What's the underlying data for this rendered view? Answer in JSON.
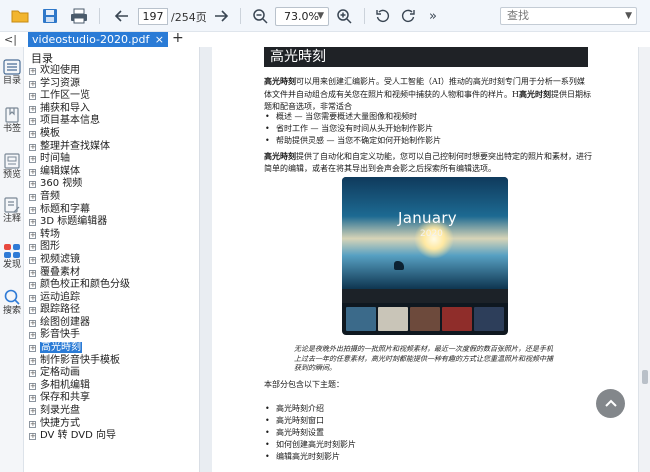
{
  "toolbar": {
    "icons": [
      "folder-icon",
      "save-icon",
      "print-icon",
      "back-arrow-icon",
      "forward-arrow-icon",
      "zoom-out-icon",
      "zoom-in-icon",
      "rotate-left-icon",
      "rotate-right-icon",
      "more-icon"
    ],
    "page_current": "197",
    "page_total": "/254页",
    "zoom": "73.0%",
    "search_placeholder": "查找",
    "more_label": "»"
  },
  "tabs": {
    "toggle": "<|",
    "active_tab": "videostudio-2020.pdf",
    "close": "×",
    "add": "+"
  },
  "rail": {
    "items": [
      {
        "label": "目录",
        "icon": "toc-icon"
      },
      {
        "label": "书签",
        "icon": "bookmark-icon"
      },
      {
        "label": "预览",
        "icon": "preview-icon"
      },
      {
        "label": "注释",
        "icon": "annotation-icon"
      },
      {
        "label": "发现",
        "icon": "discover-icon"
      },
      {
        "label": "搜索",
        "icon": "search-icon"
      }
    ]
  },
  "panel": {
    "title": "目录",
    "items": [
      "欢迎使用",
      "学习资源",
      "工作区一览",
      "捕获和导入",
      "项目基本信息",
      "模板",
      "整理并查找媒体",
      "时间轴",
      "编辑媒体",
      "360 视频",
      "音频",
      "标题和字幕",
      "3D 标题编辑器",
      "转场",
      "图形",
      "视频滤镜",
      "覆叠素材",
      "颜色校正和颜色分级",
      "运动追踪",
      "跟踪路径",
      "绘图创建器",
      "影音快手",
      "高光時刻",
      "制作影音快手模板",
      "定格动画",
      "多相机编辑",
      "保存和共享",
      "刻录光盘",
      "快捷方式",
      "DV 转 DVD 向导"
    ],
    "active_index": 22
  },
  "document": {
    "header_title": "高光時刻",
    "intro_bold": "高光時刻",
    "intro_rest": "可以用来创建汇编影片。受人工智能（AI）推动的高光时刻专门用于分析一系列媒体文件并自动组合成有关您在照片和视频中捕获的人物和事件的样片。H",
    "intro_bold2": "高光时刻",
    "intro_tail": "提供日期标题和配音选项，非常适合",
    "bullets1": [
      "概述 — 当您需要概述大量图像和视频时",
      "省时工作 — 当您没有时间从头开始制作影片",
      "帮助提供灵感 — 当您不确定如何开始制作影片"
    ],
    "para2_bold": "高光時刻",
    "para2_rest": "提供了自动化和自定义功能，您可以自己控制何时想要突出特定的照片和素材，进行简单的编辑，或者在将其导出到会声会影之后探索所有编辑选项。",
    "video_title": "January",
    "video_sub": "2020",
    "caption": "无论是夜晚外出拍摄的一批照片和视频素材，最近一次度假的数百张照片，还是手机上过去一年的任意素材，高光时刻都能提供一种有趣的方式让您重温照片和视频中捕获到的瞬间。",
    "section_intro": "本部分包含以下主题：",
    "topics": [
      "高光時刻介绍",
      "高光時刻窗口",
      "高光時刻设置",
      "如何创建高光时刻影片",
      "编辑高光时刻影片"
    ]
  },
  "scroll_up_icon": "chevron-up-icon"
}
